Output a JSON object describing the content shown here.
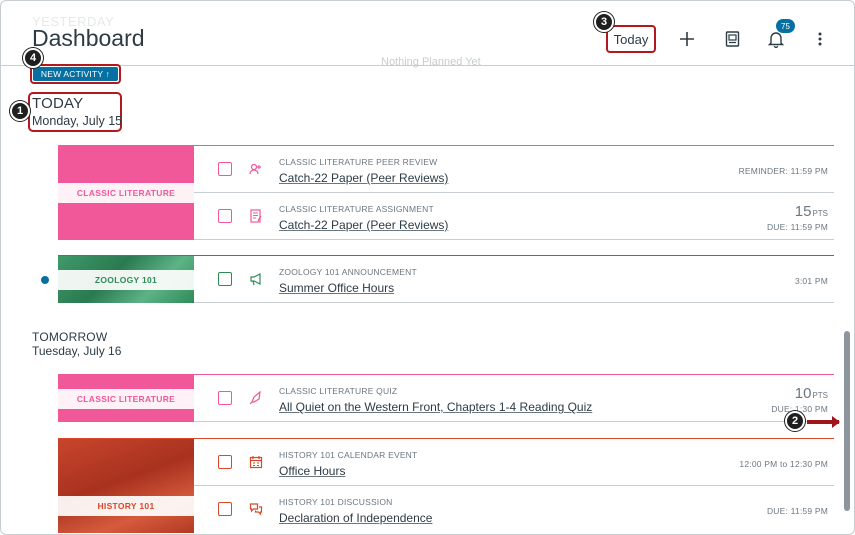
{
  "header": {
    "title": "Dashboard",
    "ghost_day": "YESTERDAY",
    "ghost_status": "Nothing Planned Yet",
    "today_label": "Today",
    "new_activity_label": "NEW ACTIVITY ↑",
    "notification_count": "75"
  },
  "callouts": [
    "1",
    "2",
    "3",
    "4"
  ],
  "days": [
    {
      "heading": "TODAY",
      "date": "Monday, July 15"
    },
    {
      "heading": "TOMORROW",
      "date": "Tuesday, July 16"
    }
  ],
  "groups": [
    {
      "course": "CLASSIC LITERATURE",
      "color": "#f0589a",
      "items": [
        {
          "type": "CLASSIC LITERATURE PEER REVIEW",
          "title": "Catch-22 Paper (Peer Reviews)",
          "meta": "REMINDER: 11:59 PM",
          "icon": "peer-review-icon"
        },
        {
          "type": "CLASSIC LITERATURE ASSIGNMENT",
          "title": "Catch-22 Paper (Peer Reviews)",
          "points": "15",
          "pts_label": "PTS",
          "meta": "DUE: 11:59 PM",
          "icon": "assignment-icon"
        }
      ]
    },
    {
      "course": "ZOOLOGY 101",
      "color": "#2e8b57",
      "items": [
        {
          "type": "ZOOLOGY 101 ANNOUNCEMENT",
          "title": "Summer Office Hours",
          "meta": "3:01 PM",
          "icon": "announcement-icon"
        }
      ]
    },
    {
      "course": "CLASSIC LITERATURE",
      "color": "#f0589a",
      "items": [
        {
          "type": "CLASSIC LITERATURE QUIZ",
          "title": "All Quiet on the Western Front, Chapters 1-4 Reading Quiz",
          "points": "10",
          "pts_label": "PTS",
          "meta": "DUE: 1:30 PM",
          "icon": "quiz-icon"
        }
      ]
    },
    {
      "course": "HISTORY 101",
      "color": "#d9482b",
      "items": [
        {
          "type": "HISTORY 101 CALENDAR EVENT",
          "title": "Office Hours",
          "meta": "12:00 PM to 12:30 PM",
          "icon": "calendar-icon"
        },
        {
          "type": "HISTORY 101 DISCUSSION",
          "title": "Declaration of Independence",
          "meta": "DUE: 11:59 PM",
          "icon": "discussion-icon"
        }
      ]
    }
  ]
}
